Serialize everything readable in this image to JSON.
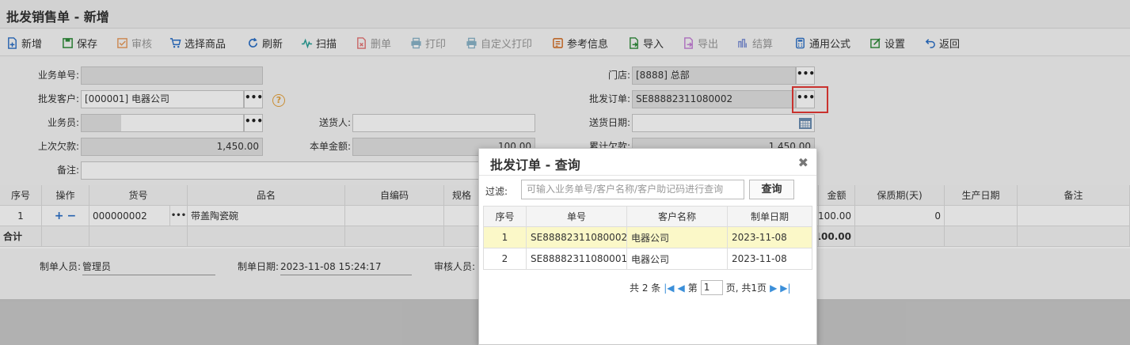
{
  "window": {
    "title": "批发销售单 - 新增"
  },
  "toolbar": [
    {
      "label": "新增",
      "icon": "new-doc-icon",
      "enabled": true
    },
    {
      "label": "保存",
      "icon": "save-icon",
      "enabled": true
    },
    {
      "label": "审核",
      "icon": "approve-icon",
      "enabled": false
    },
    {
      "label": "选择商品",
      "icon": "cart-icon",
      "enabled": true
    },
    {
      "label": "刷新",
      "icon": "refresh-icon",
      "enabled": true
    },
    {
      "label": "扫描",
      "icon": "scan-icon",
      "enabled": true
    },
    {
      "label": "删单",
      "icon": "delete-doc-icon",
      "enabled": false
    },
    {
      "label": "打印",
      "icon": "print-icon",
      "enabled": false
    },
    {
      "label": "自定义打印",
      "icon": "custom-print-icon",
      "enabled": false
    },
    {
      "label": "参考信息",
      "icon": "info-icon",
      "enabled": true
    },
    {
      "label": "导入",
      "icon": "import-icon",
      "enabled": true
    },
    {
      "label": "导出",
      "icon": "export-icon",
      "enabled": false
    },
    {
      "label": "结算",
      "icon": "settle-icon",
      "enabled": false
    },
    {
      "label": "通用公式",
      "icon": "calculator-icon",
      "enabled": true
    },
    {
      "label": "设置",
      "icon": "settings-icon",
      "enabled": true
    },
    {
      "label": "返回",
      "icon": "back-icon",
      "enabled": true
    }
  ],
  "form": {
    "order_no_label": "业务单号:",
    "order_no": "",
    "customer_label": "批发客户:",
    "customer": "[000001] 电器公司",
    "salesman_label": "业务员:",
    "salesman": "",
    "deliverer_label": "送货人:",
    "deliverer": "",
    "last_debt_label": "上次欠款:",
    "last_debt": "1,450.00",
    "amount_label": "本单金额:",
    "amount": "100.00",
    "remark_label": "备注:",
    "remark": "",
    "store_label": "门店:",
    "store": "[8888] 总部",
    "wholesale_order_label": "批发订单:",
    "wholesale_order": "SE88882311080002",
    "delivery_date_label": "送货日期:",
    "delivery_date": "",
    "total_debt_label": "累计欠款:",
    "total_debt": "1,450.00",
    "help": "?"
  },
  "grid": {
    "headers": [
      "序号",
      "操作",
      "货号",
      "品名",
      "自编码",
      "规格",
      "金额",
      "保质期(天)",
      "生产日期",
      "备注"
    ],
    "rows": [
      {
        "seq": "1",
        "op_add": "+",
        "op_remove": "−",
        "code": "000000002",
        "name": "带盖陶瓷碗",
        "self_code": "",
        "spec": "",
        "amount": "100.00",
        "shelf_life": "0",
        "prod_date": "",
        "remark": ""
      }
    ],
    "total_label": "合计",
    "total_amount": "100.00"
  },
  "footer": {
    "maker_label": "制单人员:",
    "maker": "管理员",
    "make_date_label": "制单日期:",
    "make_date": "2023-11-08 15:24:17",
    "auditor_label": "审核人员:",
    "auditor": ""
  },
  "dialog": {
    "title": "批发订单 - 查询",
    "close": "✖",
    "filter_label": "过滤:",
    "filter_placeholder": "可输入业务单号/客户名称/客户助记码进行查询",
    "query_button": "查询",
    "headers": [
      "序号",
      "单号",
      "客户名称",
      "制单日期"
    ],
    "rows": [
      {
        "seq": "1",
        "no": "SE88882311080002",
        "customer": "电器公司",
        "date": "2023-11-08"
      },
      {
        "seq": "2",
        "no": "SE88882311080001",
        "customer": "电器公司",
        "date": "2023-11-08"
      }
    ],
    "pager": {
      "total": "共 2 条",
      "page_prefix": "第",
      "page": "1",
      "page_suffix": "页, 共1页"
    }
  },
  "colors": {
    "accent": "#2a6fc7",
    "highlight_row": "#fbf8c8",
    "red_box": "#e53935"
  }
}
